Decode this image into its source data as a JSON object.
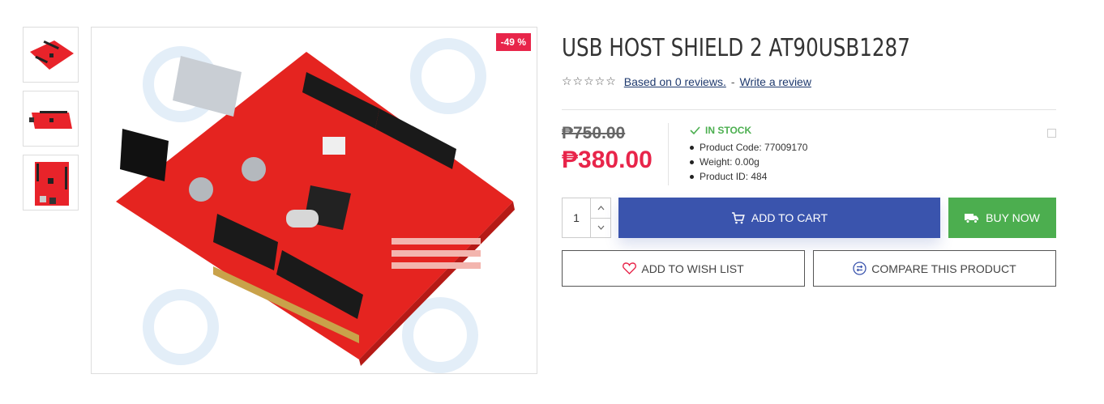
{
  "gallery": {
    "thumbnails": [
      "thumb-1",
      "thumb-2",
      "thumb-3"
    ],
    "discount_badge": "-49 %"
  },
  "product": {
    "title": "USB HOST SHIELD 2 AT90USB1287",
    "rating": {
      "stars": "☆☆☆☆☆",
      "reviews_link": "Based on 0 reviews.",
      "separator": "-",
      "write_review": "Write a review"
    },
    "old_price": "₱750.00",
    "new_price": "₱380.00",
    "stock": "IN STOCK",
    "info": [
      "Product Code: 77009170",
      "Weight: 0.00g",
      "Product ID: 484"
    ],
    "quantity": "1",
    "add_to_cart": "ADD TO CART",
    "buy_now": "BUY NOW",
    "wishlist": "ADD TO WISH LIST",
    "compare": "COMPARE THIS PRODUCT"
  },
  "colors": {
    "accent_blue": "#3a54ad",
    "buy_green": "#4cae4f",
    "price_red": "#e8254a",
    "stock_green": "#4caf50"
  }
}
